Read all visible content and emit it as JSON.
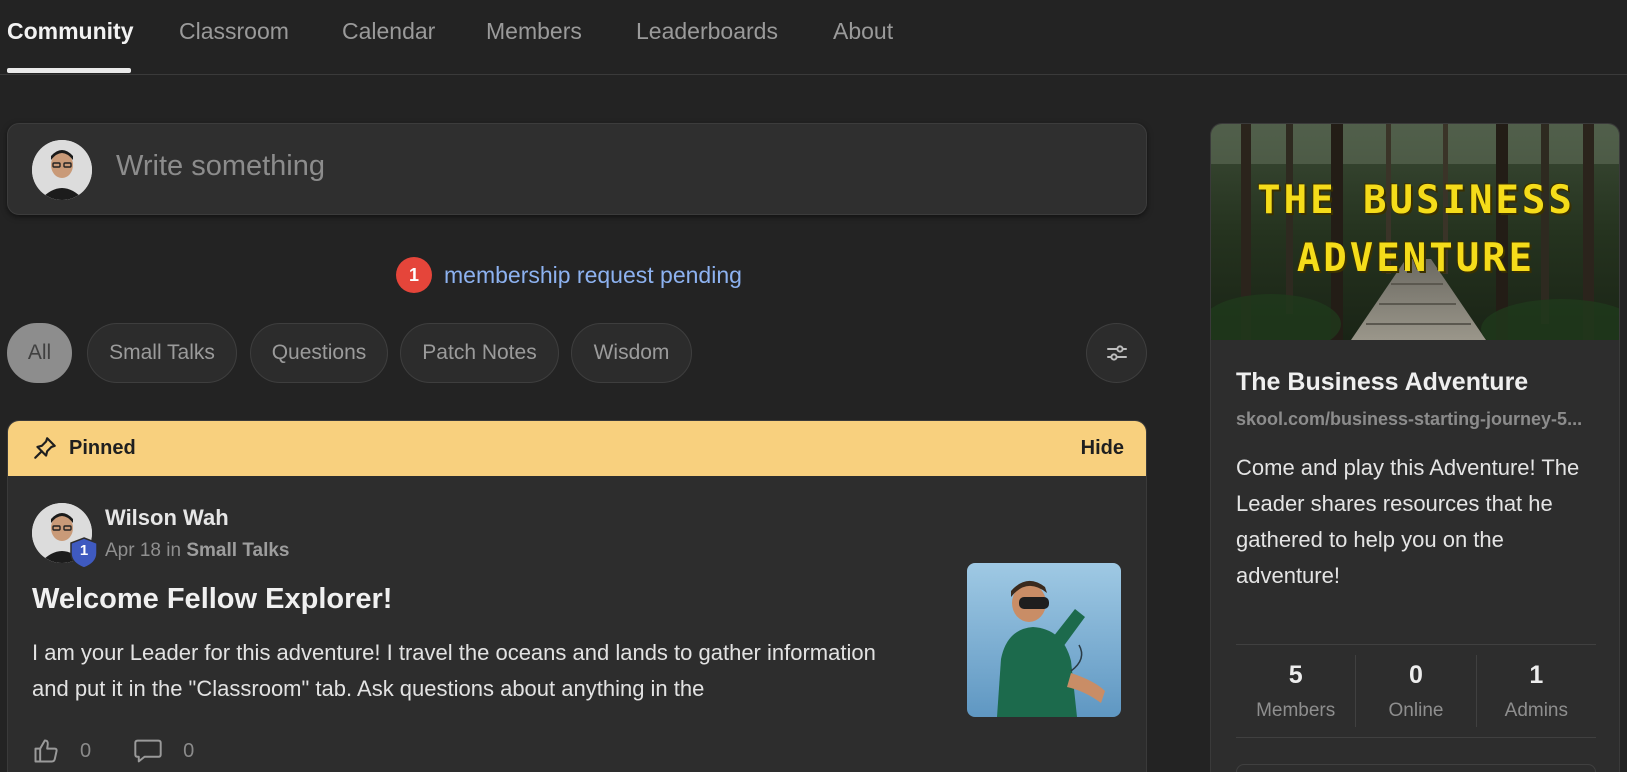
{
  "nav": {
    "tabs": [
      {
        "label": "Community",
        "active": true
      },
      {
        "label": "Classroom"
      },
      {
        "label": "Calendar"
      },
      {
        "label": "Members"
      },
      {
        "label": "Leaderboards"
      },
      {
        "label": "About"
      }
    ]
  },
  "composer": {
    "placeholder": "Write something"
  },
  "pending": {
    "count": "1",
    "text": "membership request pending"
  },
  "filters": {
    "chips": [
      "All",
      "Small Talks",
      "Questions",
      "Patch Notes",
      "Wisdom"
    ],
    "active": "All",
    "settings_icon": "sliders-icon"
  },
  "post": {
    "pinned_label": "Pinned",
    "hide_label": "Hide",
    "author": "Wilson Wah",
    "level": "1",
    "date": "Apr 18",
    "in_word": "in",
    "category": "Small Talks",
    "title": "Welcome Fellow Explorer!",
    "body": "I am your Leader for this adventure! I travel the oceans and lands to gather information and put it in the \"Classroom\" tab. Ask questions about anything in the",
    "likes": "0",
    "comments": "0"
  },
  "group": {
    "banner_line1": "THE BUSINESS",
    "banner_line2": "ADVENTURE",
    "name": "The Business Adventure",
    "url": "skool.com/business-starting-journey-5...",
    "description": "Come and play this Adventure! The Leader shares resources that he gathered to help you on the adventure!",
    "stats": [
      {
        "value": "5",
        "label": "Members"
      },
      {
        "value": "0",
        "label": "Online"
      },
      {
        "value": "1",
        "label": "Admins"
      }
    ]
  },
  "colors": {
    "background": "#232323",
    "pinned_bar": "#f8d07e",
    "pending_badge": "#e5453a",
    "link": "#8db2f0",
    "banner_text": "#f5dc1a",
    "level_badge": "#3f5ac0"
  }
}
